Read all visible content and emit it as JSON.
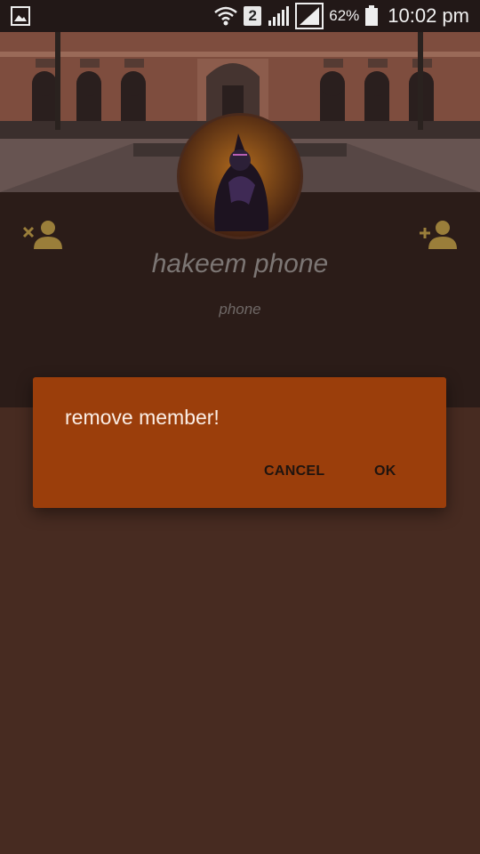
{
  "status_bar": {
    "battery_percent": "62%",
    "time": "10:02 pm",
    "sim_slot": "2",
    "icons": [
      "image-notification-icon",
      "wifi-icon",
      "signal-icon",
      "battery-icon"
    ]
  },
  "profile": {
    "name": "hakeem phone",
    "subtitle": "phone",
    "remove_member_icon": "remove-person-icon",
    "add_member_icon": "add-person-icon"
  },
  "dialog": {
    "title": "remove member!",
    "cancel_label": "CANCEL",
    "ok_label": "OK"
  },
  "colors": {
    "dialog_bg": "#9b3e0b",
    "accent_icon": "#9a7e3a",
    "page_bg": "#472b21"
  }
}
